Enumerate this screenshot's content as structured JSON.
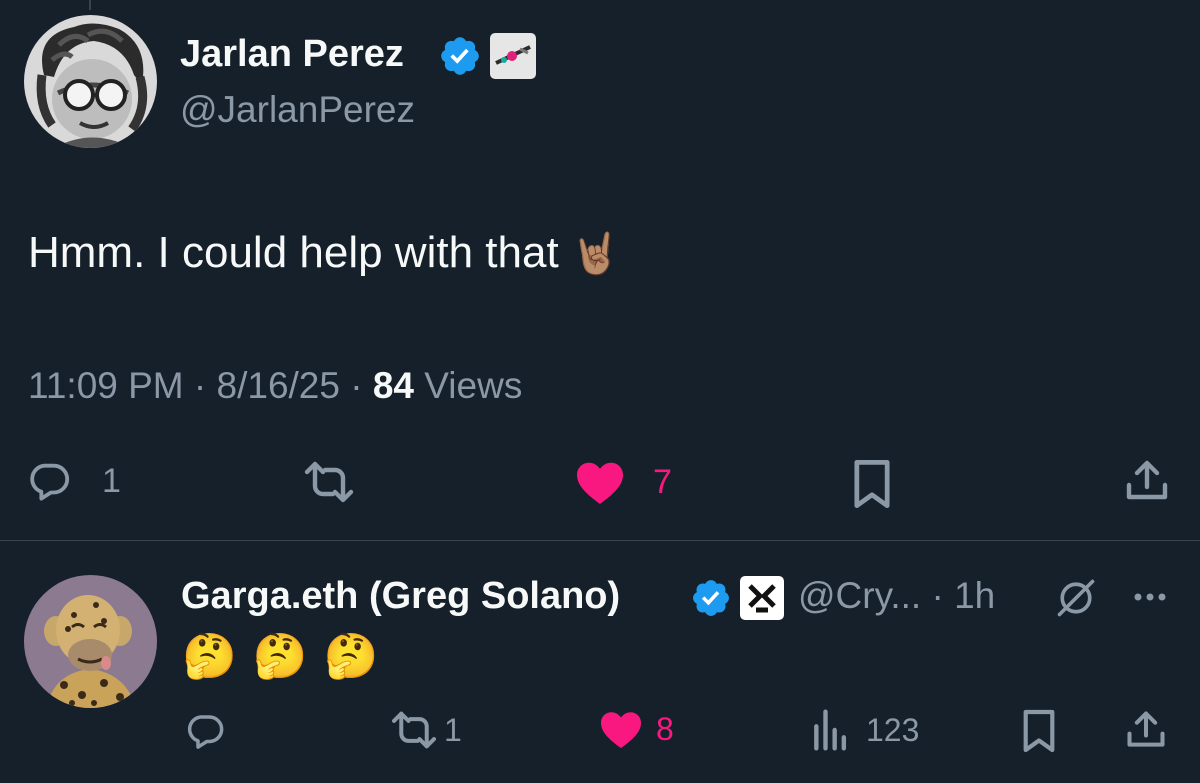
{
  "main_tweet": {
    "display_name": "Jarlan Perez",
    "handle": "@JarlanPerez",
    "text": "Hmm. I could help with that",
    "text_emoji": "🤘🏽",
    "time": "11:09 PM",
    "separator": "·",
    "date": "8/16/25",
    "views_count": "84",
    "views_label": "Views",
    "reply_count": "1",
    "like_count": "7",
    "liked": true
  },
  "reply_tweet": {
    "display_name": "Garga.eth (Greg Solano)",
    "handle": "@Cry...",
    "separator": "·",
    "age": "1h",
    "emojis": [
      "🤔",
      "🤔",
      "🤔"
    ],
    "retweet_count": "1",
    "like_count": "8",
    "views_count": "123",
    "liked": true
  },
  "colors": {
    "background": "#15202b",
    "text_primary": "#f7f9f9",
    "text_secondary": "#8b98a5",
    "verified_blue": "#1d9bf0",
    "like_pink": "#f91880",
    "divider": "#38444d"
  },
  "icons": {
    "reply": "speech-bubble-icon",
    "retweet": "retweet-arrows-icon",
    "like": "heart-icon",
    "bookmark": "bookmark-icon",
    "share": "share-upload-icon",
    "views": "bar-chart-icon",
    "grok": "grok-slash-circle-icon",
    "more": "ellipsis-icon"
  }
}
